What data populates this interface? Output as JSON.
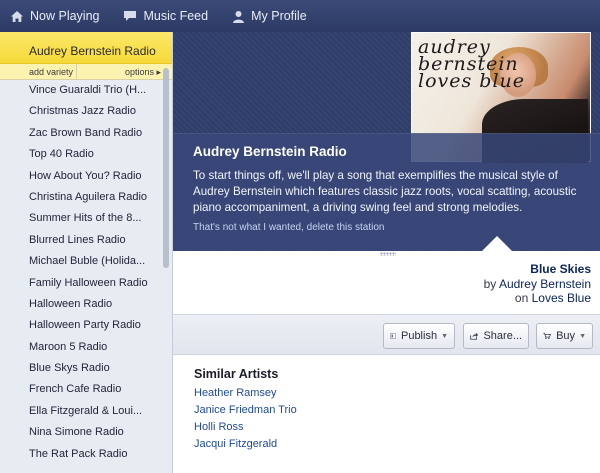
{
  "nav": {
    "now_playing": "Now Playing",
    "music_feed": "Music Feed",
    "my_profile": "My Profile"
  },
  "sidebar": {
    "active_station": "Audrey Bernstein Radio",
    "add_variety": "add variety",
    "options": "options ▸",
    "stations": [
      "Vince Guaraldi Trio (H...",
      "Christmas Jazz Radio",
      "Zac Brown Band Radio",
      "Top 40 Radio",
      "How About You? Radio",
      "Christina Aguilera Radio",
      "Summer Hits of the 8...",
      "Blurred Lines Radio",
      "Michael Buble (Holida...",
      "Family Halloween Radio",
      "Halloween Radio",
      "Halloween Party Radio",
      "Maroon 5 Radio",
      "Blue Skys Radio",
      "French Cafe Radio",
      "Ella Fitzgerald & Loui...",
      "Nina Simone Radio",
      "The Rat Pack Radio"
    ]
  },
  "hero": {
    "album_text_line1": "audrey bernstein",
    "album_text_line2": "loves blue",
    "title": "Audrey Bernstein Radio",
    "description": "To start things off, we'll play a song that exemplifies the musical style of Audrey Bernstein which features classic jazz roots, vocal scatting, acoustic piano accompaniment, a driving swing feel and strong melodies.",
    "link": "That's not what I wanted, delete this station"
  },
  "track": {
    "song": "Blue Skies",
    "by_prefix": "by",
    "artist": "Audrey Bernstein",
    "on_prefix": "on",
    "album": "Loves Blue"
  },
  "toolbar": {
    "publish": "Publish",
    "share": "Share...",
    "buy": "Buy"
  },
  "similar": {
    "title": "Similar Artists",
    "artists": [
      "Heather Ramsey",
      "Janice Friedman Trio",
      "Holli Ross",
      "Jacqui Fitzgerald"
    ]
  }
}
